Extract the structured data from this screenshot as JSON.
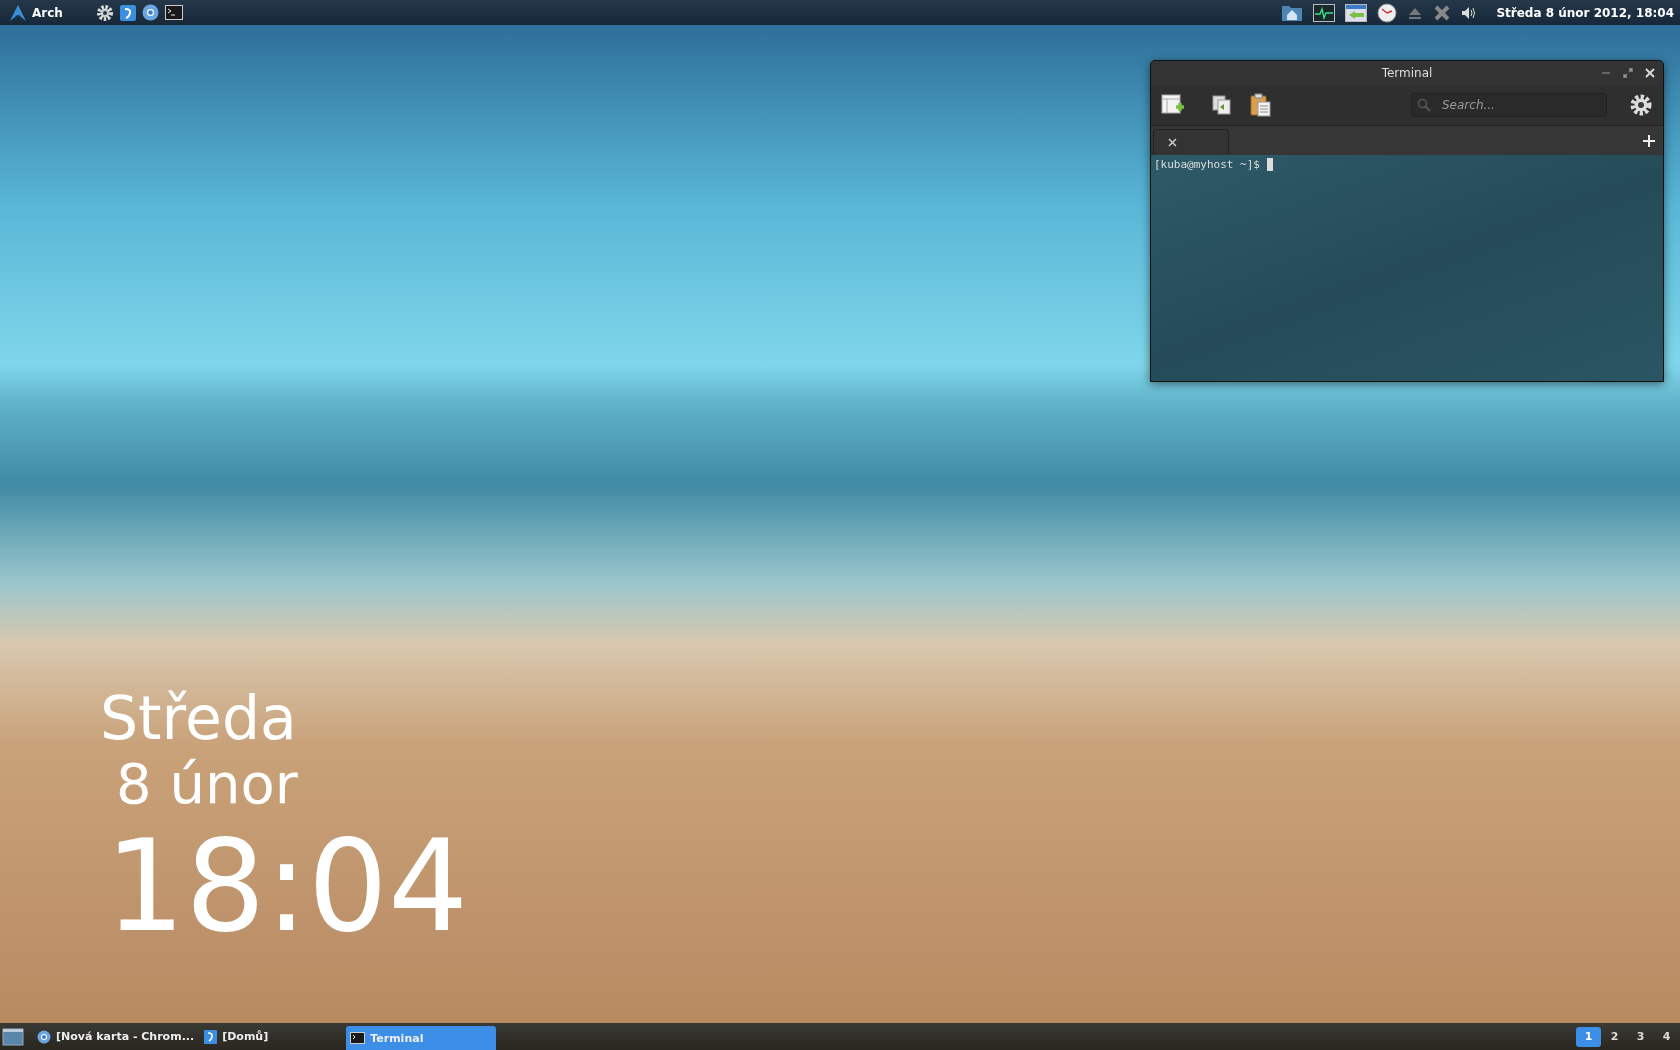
{
  "top_panel": {
    "menu_label": "Arch",
    "clock": "Středa  8 únor 2012, 18:04"
  },
  "terminal_window": {
    "title": "Terminal",
    "search": {
      "placeholder": "Search..."
    },
    "prompt": "[kuba@myhost ~]$"
  },
  "desktop_clock": {
    "weekday": "Středa",
    "date": "8 únor",
    "time": "18:04"
  },
  "taskbar": {
    "tasks": [
      {
        "label": "[Nová karta - Chrom...",
        "kind": "browser",
        "selected": false
      },
      {
        "label": "[Domů]",
        "kind": "files",
        "selected": false
      },
      {
        "label": "Terminal",
        "kind": "terminal",
        "selected": true
      }
    ],
    "workspaces": [
      {
        "label": "1",
        "selected": true
      },
      {
        "label": "2",
        "selected": false
      },
      {
        "label": "3",
        "selected": false
      },
      {
        "label": "4",
        "selected": false
      }
    ]
  }
}
